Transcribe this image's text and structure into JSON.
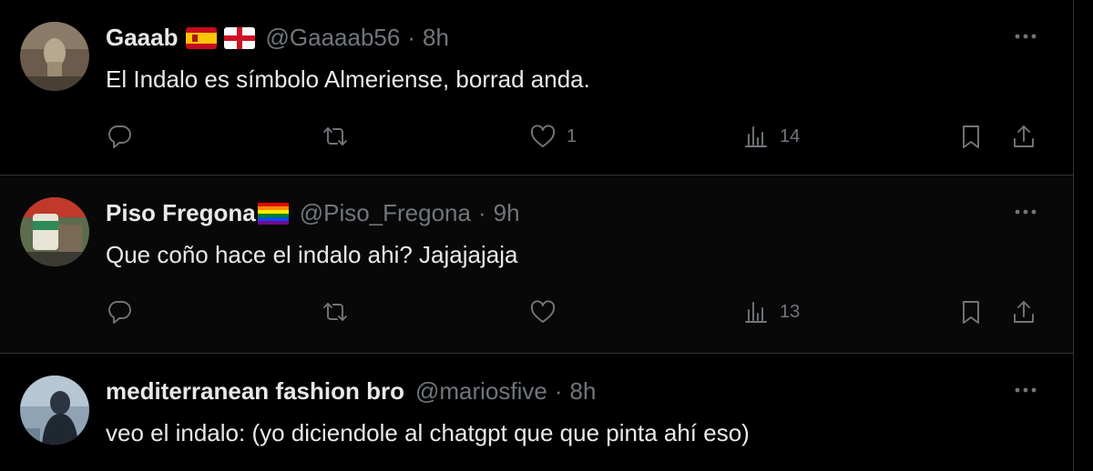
{
  "tweets": [
    {
      "display_name": "Gaaab",
      "handle": "@Gaaaab56",
      "separator": "·",
      "time": "8h",
      "text": "El Indalo es símbolo Almeriense, borrad anda.",
      "flags": [
        "spain-flag-icon",
        "england-flag-icon"
      ],
      "likes": "1",
      "views": "14"
    },
    {
      "display_name": "Piso Fregona",
      "handle": "@Piso_Fregona",
      "separator": "·",
      "time": "9h",
      "text": "Que coño hace el indalo ahi? Jajajajaja",
      "flags": [
        "rainbow-flag-icon"
      ],
      "likes": "",
      "views": "13"
    },
    {
      "display_name": "mediterranean fashion bro",
      "handle": "@mariosfive",
      "separator": "·",
      "time": "8h",
      "text": "veo el indalo: (yo diciendole al chatgpt que que pinta ahí eso)",
      "flags": [],
      "likes": "",
      "views": ""
    }
  ],
  "colors": {
    "background": "#000000",
    "text_primary": "#e7e9ea",
    "text_secondary": "#71767b",
    "divider": "#2f3336"
  }
}
